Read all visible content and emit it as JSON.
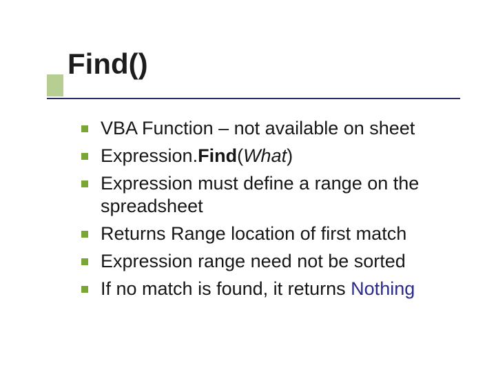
{
  "slide": {
    "title": "Find()",
    "bullets": [
      {
        "segments": [
          {
            "t": "VBA Function – not available on sheet"
          }
        ]
      },
      {
        "segments": [
          {
            "t": "Expression."
          },
          {
            "t": "Find",
            "bold": true
          },
          {
            "t": "("
          },
          {
            "t": "What",
            "italic": true
          },
          {
            "t": ")"
          }
        ]
      },
      {
        "segments": [
          {
            "t": "Expression must define a range on the spreadsheet"
          }
        ]
      },
      {
        "segments": [
          {
            "t": "Returns Range location of first match"
          }
        ]
      },
      {
        "segments": [
          {
            "t": "Expression range need not be sorted"
          }
        ]
      },
      {
        "segments": [
          {
            "t": "If no match is found, it returns "
          },
          {
            "t": "Nothing",
            "keyword": true
          }
        ]
      }
    ]
  }
}
